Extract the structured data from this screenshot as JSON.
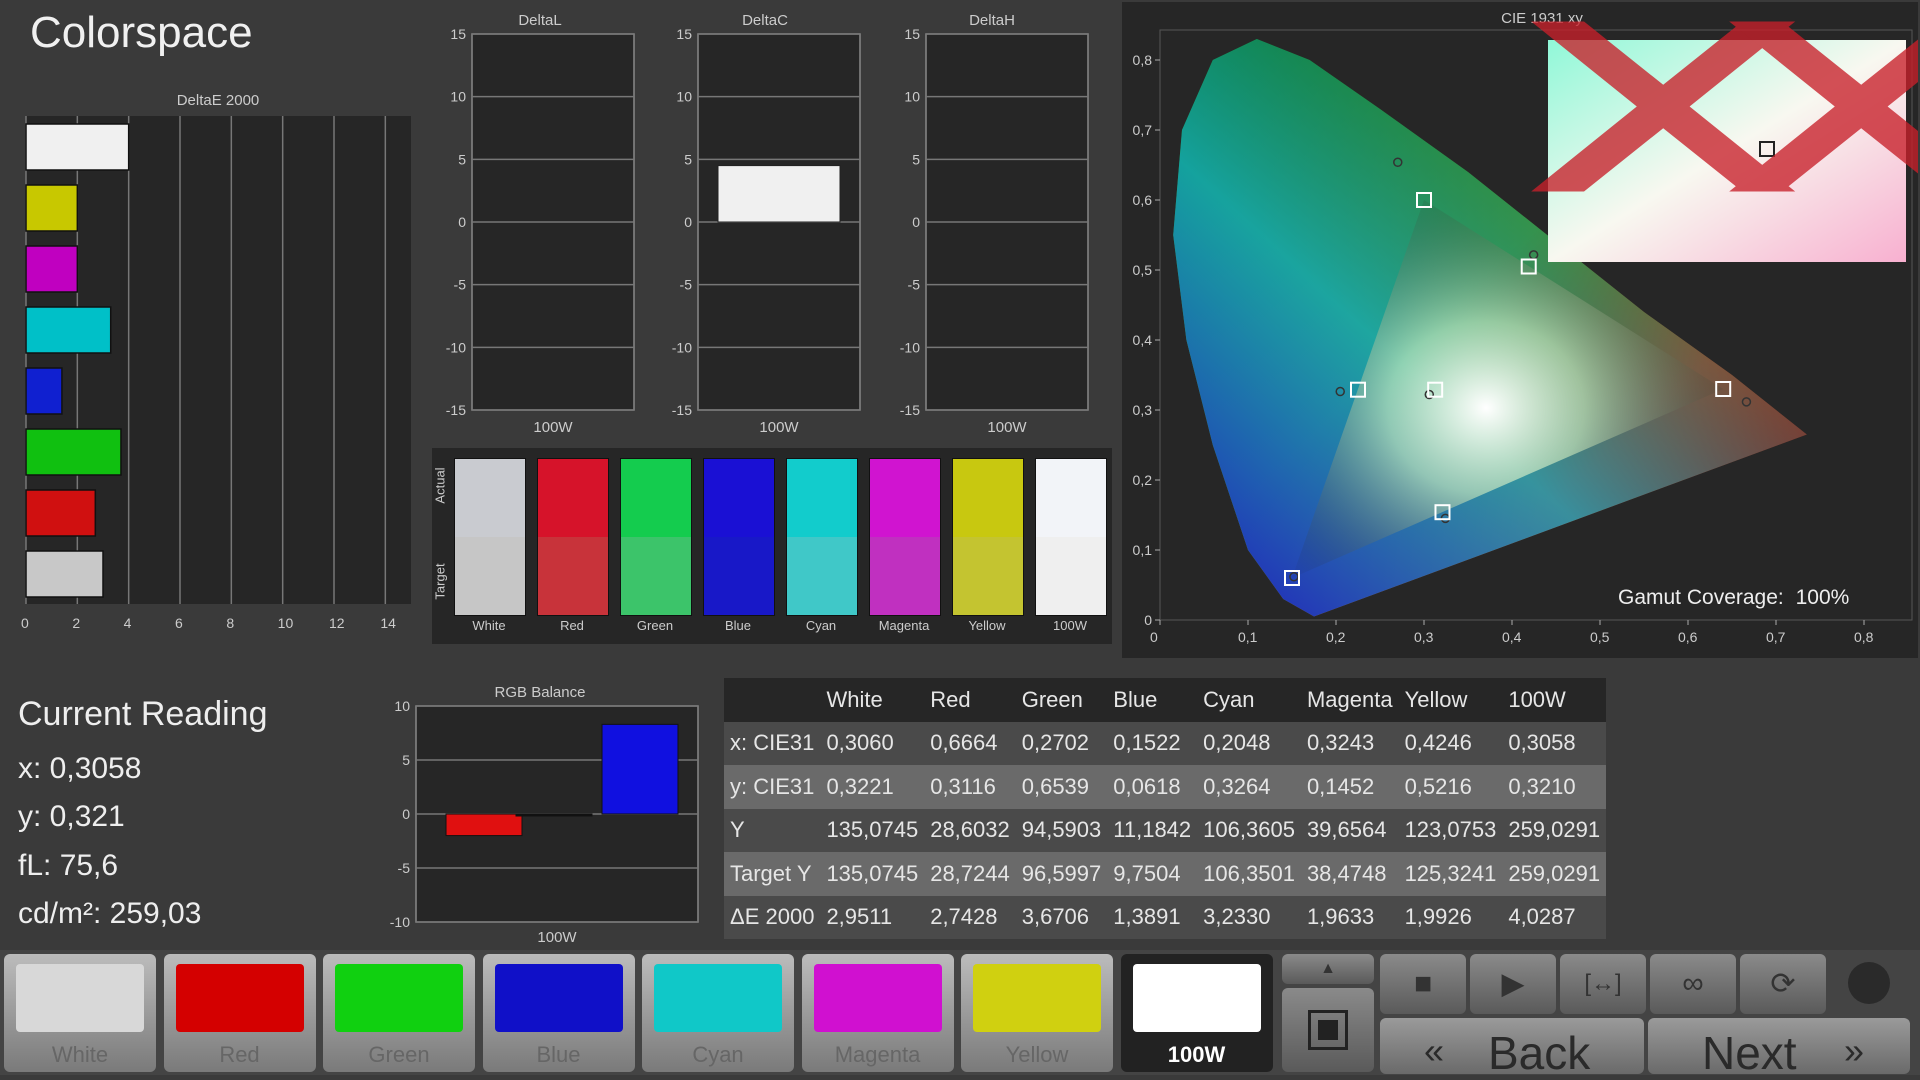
{
  "page": {
    "title": "Colorspace"
  },
  "deltae": {
    "title": "DeltaE 2000",
    "ticks": [
      "0",
      "2",
      "4",
      "6",
      "8",
      "10",
      "12",
      "14"
    ],
    "bars": [
      {
        "label": "White",
        "value": 4.0,
        "color": "#f0f0f0"
      },
      {
        "label": "Yellow",
        "value": 2.0,
        "color": "#c8c800"
      },
      {
        "label": "Magenta",
        "value": 2.0,
        "color": "#c000c0"
      },
      {
        "label": "Cyan",
        "value": 3.3,
        "color": "#00c0c8"
      },
      {
        "label": "Blue",
        "value": 1.4,
        "color": "#1020d0"
      },
      {
        "label": "Green",
        "value": 3.7,
        "color": "#10c010"
      },
      {
        "label": "Red",
        "value": 2.7,
        "color": "#d01010"
      },
      {
        "label": "100W",
        "value": 3.0,
        "color": "#c8c8c8"
      }
    ]
  },
  "dl": {
    "title": "DeltaL",
    "xlabel": "100W",
    "value": 0,
    "ticks": [
      "15",
      "10",
      "5",
      "0",
      "-5",
      "-10",
      "-15"
    ]
  },
  "dc": {
    "title": "DeltaC",
    "xlabel": "100W",
    "value": 4.5,
    "ticks": [
      "15",
      "10",
      "5",
      "0",
      "-5",
      "-10",
      "-15"
    ]
  },
  "dh": {
    "title": "DeltaH",
    "xlabel": "100W",
    "value": 0,
    "ticks": [
      "15",
      "10",
      "5",
      "0",
      "-5",
      "-10",
      "-15"
    ]
  },
  "swatches": {
    "actual_label": "Actual",
    "target_label": "Target",
    "items": [
      {
        "label": "White",
        "actual": "#c9cbd0",
        "target": "#c6c6c6"
      },
      {
        "label": "Red",
        "actual": "#d6132a",
        "target": "#c8333a"
      },
      {
        "label": "Green",
        "actual": "#14cc4e",
        "target": "#3cc46a"
      },
      {
        "label": "Blue",
        "actual": "#1a10d4",
        "target": "#1818c8"
      },
      {
        "label": "Cyan",
        "actual": "#12cccc",
        "target": "#40c8c8"
      },
      {
        "label": "Magenta",
        "actual": "#d014d0",
        "target": "#c030c0"
      },
      {
        "label": "Yellow",
        "actual": "#c8c810",
        "target": "#c4c430"
      },
      {
        "label": "100W",
        "actual": "#f2f4f8",
        "target": "#efefef"
      }
    ]
  },
  "cie": {
    "title": "CIE 1931 xy",
    "xticks": [
      "0",
      "0,1",
      "0,2",
      "0,3",
      "0,4",
      "0,5",
      "0,6",
      "0,7",
      "0,8"
    ],
    "yticks": [
      "0,8",
      "0,7",
      "0,6",
      "0,5",
      "0,4",
      "0,3",
      "0,2",
      "0,1",
      "0"
    ],
    "gamut_label": "Gamut Coverage:",
    "gamut_value": "100%"
  },
  "reading": {
    "title": "Current Reading",
    "x": "x: 0,3058",
    "y": "y: 0,321",
    "fl": "fL: 75,6",
    "cd": "cd/m²: 259,03"
  },
  "rgb": {
    "title": "RGB Balance",
    "xlabel": "100W",
    "ticks": [
      "10",
      "5",
      "0",
      "-5",
      "-10"
    ],
    "red": -2.0,
    "green": 0,
    "blue": 8.3
  },
  "table": {
    "headers": [
      "",
      "White",
      "Red",
      "Green",
      "Blue",
      "Cyan",
      "Magenta",
      "Yellow",
      "100W"
    ],
    "rows": [
      [
        "x: CIE31",
        "0,3060",
        "0,6664",
        "0,2702",
        "0,1522",
        "0,2048",
        "0,3243",
        "0,4246",
        "0,3058"
      ],
      [
        "y: CIE31",
        "0,3221",
        "0,3116",
        "0,6539",
        "0,0618",
        "0,3264",
        "0,1452",
        "0,5216",
        "0,3210"
      ],
      [
        "Y",
        "135,0745",
        "28,6032",
        "94,5903",
        "11,1842",
        "106,3605",
        "39,6564",
        "123,0753",
        "259,0291"
      ],
      [
        "Target Y",
        "135,0745",
        "28,7244",
        "96,5997",
        "9,7504",
        "106,3501",
        "38,4748",
        "125,3241",
        "259,0291"
      ],
      [
        "ΔE 2000",
        "2,9511",
        "2,7428",
        "3,6706",
        "1,3891",
        "3,2330",
        "1,9633",
        "1,9926",
        "4,0287"
      ]
    ]
  },
  "buttons": [
    {
      "label": "White",
      "color": "#d8d8d8"
    },
    {
      "label": "Red",
      "color": "#d40000"
    },
    {
      "label": "Green",
      "color": "#10d010"
    },
    {
      "label": "Blue",
      "color": "#1010c8"
    },
    {
      "label": "Cyan",
      "color": "#10c8c8"
    },
    {
      "label": "Magenta",
      "color": "#d010d0"
    },
    {
      "label": "Yellow",
      "color": "#d0d010"
    },
    {
      "label": "100W",
      "color": "#ffffff"
    }
  ],
  "nav": {
    "back": "Back",
    "next": "Next"
  }
}
